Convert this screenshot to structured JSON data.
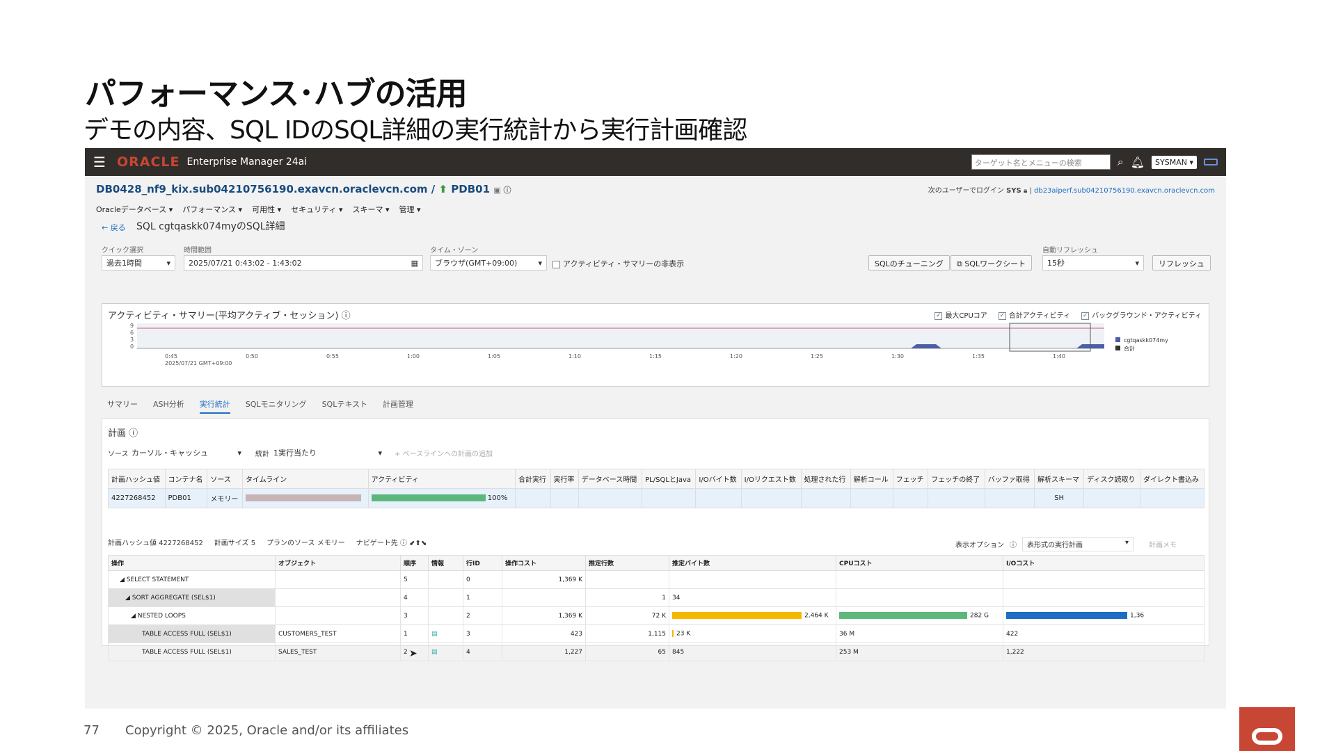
{
  "slide": {
    "title": "パフォーマンス･ハブの活用",
    "subtitle": "デモの内容、SQL IDのSQL詳細の実行統計から実行計画確認",
    "page_number": "77",
    "copyright": "Copyright © 2025, Oracle and/or its affiliates"
  },
  "topbar": {
    "logo": "ORACLE",
    "product": "Enterprise Manager 24ai",
    "search_placeholder": "ターゲット名とメニューの検索",
    "user": "SYSMAN ▾"
  },
  "header": {
    "target": "DB0428_nf9_kix.sub04210756190.exavcn.oraclevcn.com /",
    "pdb": "PDB01",
    "login_label": "次のユーザーでログイン",
    "login_user": "SYS",
    "login_link": "db23aiperf.sub04210756190.exavcn.oraclevcn.com"
  },
  "menus": [
    "Oracleデータベース ▾",
    "パフォーマンス ▾",
    "可用性 ▾",
    "セキュリティ ▾",
    "スキーマ ▾",
    "管理 ▾"
  ],
  "page": {
    "back": "← 戻る",
    "title": "SQL cgtqaskk074myのSQL詳細"
  },
  "controls": {
    "quick_label": "クイック選択",
    "quick_value": "過去1時間",
    "range_label": "時間範囲",
    "range_value": "2025/07/21 0:43:02 - 1:43:02",
    "tz_label": "タイム・ゾーン",
    "tz_value": "ブラウザ(GMT+09:00)",
    "hide_summary": "アクティビティ・サマリーの非表示",
    "tune_btn": "SQLのチューニング",
    "worksheet_btn": "SQLワークシート",
    "refresh_label": "自動リフレッシュ",
    "refresh_value": "15秒",
    "refresh_btn": "リフレッシュ"
  },
  "activity": {
    "title": "アクティビティ・サマリー(平均アクティブ・セッション)",
    "chk_cpu": "最大CPUコア",
    "chk_total": "合計アクティビティ",
    "chk_bg": "バックグラウンド・アクティビティ",
    "y_ticks": [
      "9",
      "6",
      "3",
      "0"
    ],
    "x_ticks": [
      "0:45",
      "0:50",
      "0:55",
      "1:00",
      "1:05",
      "1:10",
      "1:15",
      "1:20",
      "1:25",
      "1:30",
      "1:35",
      "1:40"
    ],
    "x_sub": "2025/07/21 GMT+09:00",
    "legend": [
      "cgtqaskk074my",
      "合計"
    ]
  },
  "tabs": [
    "サマリー",
    "ASH分析",
    "実行統計",
    "SQLモニタリング",
    "SQLテキスト",
    "計画管理"
  ],
  "plan": {
    "heading": "計画",
    "source_label": "ソース",
    "source_value": "カーソル・キャッシュ",
    "stat_label": "統計",
    "stat_value": "1実行当たり",
    "add_baseline": "+ ベースラインへの計画の追加",
    "columns": [
      "計画ハッシュ値",
      "コンテナ名",
      "ソース",
      "タイムライン",
      "アクティビティ",
      "合計実行",
      "実行率",
      "データベース時間",
      "PL/SQLとJava",
      "I/Oバイト数",
      "I/Oリクエスト数",
      "処理された行",
      "解析コール",
      "フェッチ",
      "フェッチの終了",
      "バッファ取得",
      "解析スキーマ",
      "ディスク読取り",
      "ダイレクト書込み"
    ],
    "row": {
      "hash": "4227268452",
      "container": "PDB01",
      "source": "メモリー",
      "activity_pct": "100%",
      "schema": "SH"
    }
  },
  "plan_detail": {
    "hash_label": "計画ハッシュ値 4227268452",
    "size_label": "計画サイズ 5",
    "source_label": "プランのソース メモリー",
    "nav_label": "ナビゲート先",
    "display_option": "表示オプション",
    "display_value": "表形式の実行計画",
    "memo": "計画メモ",
    "columns": [
      "操作",
      "オブジェクト",
      "順序",
      "情報",
      "行ID",
      "操作コスト",
      "推定行数",
      "推定バイト数",
      "CPUコスト",
      "I/Oコスト"
    ],
    "rows": [
      {
        "op": "◢ SELECT STATEMENT",
        "obj": "",
        "order": "5",
        "id": "0",
        "cost": "1,369 K",
        "rows": "",
        "bytes": "",
        "cpu": "",
        "io": ""
      },
      {
        "op": "◢ SORT AGGREGATE (SEL$1)",
        "obj": "",
        "order": "4",
        "id": "1",
        "cost": "",
        "rows": "1",
        "bytes": "34",
        "cpu": "",
        "io": ""
      },
      {
        "op": "◢ NESTED LOOPS",
        "obj": "",
        "order": "3",
        "id": "2",
        "cost": "1,369 K",
        "rows": "72 K",
        "bytes": "2,464 K",
        "cpu": "282 G",
        "io": "1,36"
      },
      {
        "op": "TABLE ACCESS FULL (SEL$1)",
        "obj": "CUSTOMERS_TEST",
        "order": "1",
        "id": "3",
        "cost": "423",
        "rows": "1,115",
        "bytes": "23 K",
        "cpu": "36 M",
        "io": "422"
      },
      {
        "op": "TABLE ACCESS FULL (SEL$1)",
        "obj": "SALES_TEST",
        "order": "2",
        "id": "4",
        "cost": "1,227",
        "rows": "65",
        "bytes": "845",
        "cpu": "253 M",
        "io": "1,222"
      }
    ]
  },
  "colors": {
    "oracle_red": "#c74634",
    "link_blue": "#1b6ec2",
    "bar_yellow": "#f5b800",
    "bar_green": "#5cb87a",
    "bar_blue": "#1b6ec2"
  }
}
